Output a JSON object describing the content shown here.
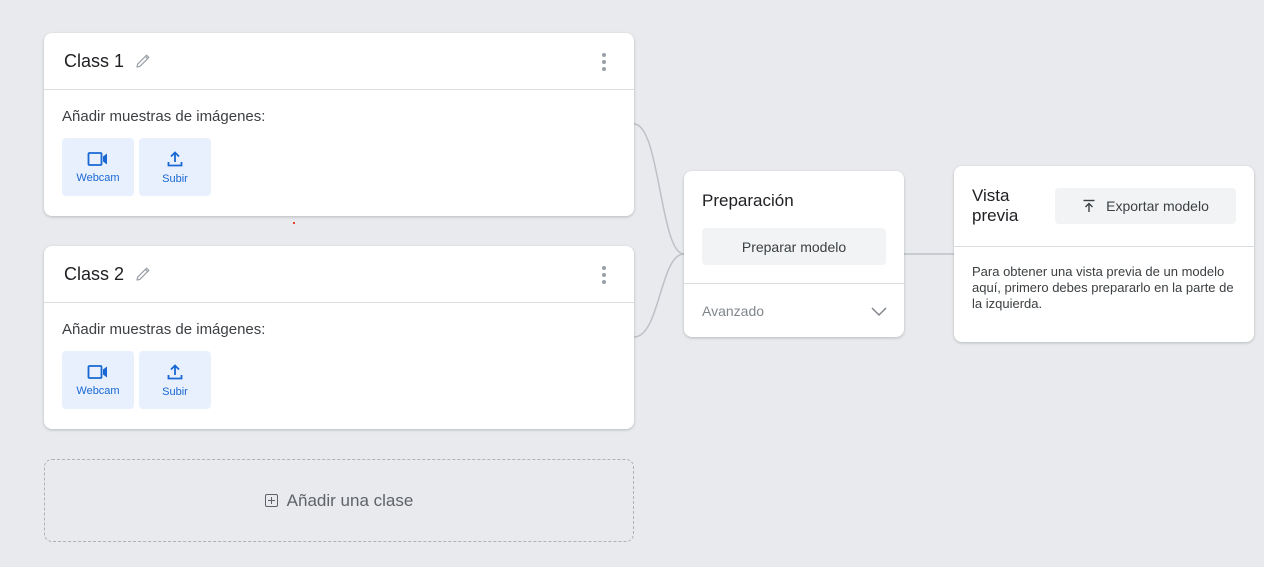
{
  "colors": {
    "background": "#e8eaed",
    "card": "#ffffff",
    "accent_blue": "#1967d2",
    "source_button_bg": "#e8f0fe"
  },
  "classes": [
    {
      "title": "Class 1",
      "samples_label": "Añadir muestras de imágenes:",
      "buttons": [
        {
          "label": "Webcam",
          "icon": "videocam-icon"
        },
        {
          "label": "Subir",
          "icon": "upload-icon"
        }
      ]
    },
    {
      "title": "Class 2",
      "samples_label": "Añadir muestras de imágenes:",
      "buttons": [
        {
          "label": "Webcam",
          "icon": "videocam-icon"
        },
        {
          "label": "Subir",
          "icon": "upload-icon"
        }
      ]
    }
  ],
  "add_class": {
    "label": "Añadir una clase",
    "icon": "add-box-icon"
  },
  "training": {
    "title": "Preparación",
    "train_button": "Preparar modelo",
    "advanced_label": "Avanzado",
    "advanced_icon": "chevron-down-icon"
  },
  "preview": {
    "title": "Vista previa",
    "export_button": "Exportar modelo",
    "export_icon": "upload-arrow-icon",
    "message": "Para obtener una vista previa de un modelo aquí, primero debes prepararlo en la parte de la izquierda."
  }
}
